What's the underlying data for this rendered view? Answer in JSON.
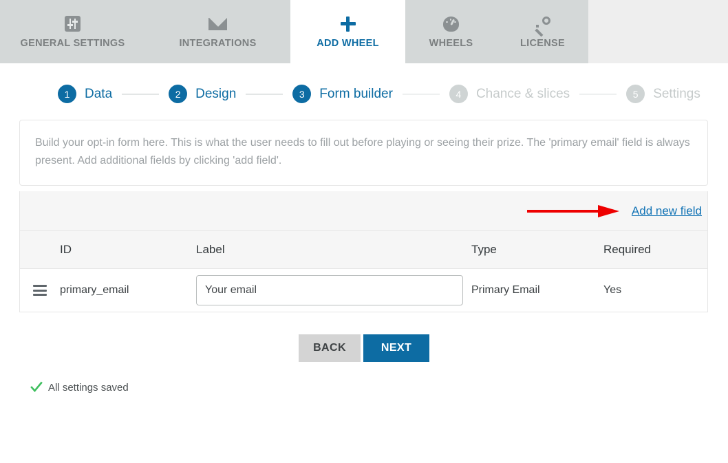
{
  "tabs": [
    {
      "label": "GENERAL SETTINGS",
      "icon": "sliders-icon",
      "active": false
    },
    {
      "label": "INTEGRATIONS",
      "icon": "envelope-icon",
      "active": false
    },
    {
      "label": "ADD WHEEL",
      "icon": "plus-icon",
      "active": true
    },
    {
      "label": "WHEELS",
      "icon": "gauge-icon",
      "active": false
    },
    {
      "label": "LICENSE",
      "icon": "key-icon",
      "active": false
    }
  ],
  "steps": [
    {
      "number": "1",
      "label": "Data",
      "active": true
    },
    {
      "number": "2",
      "label": "Design",
      "active": true
    },
    {
      "number": "3",
      "label": "Form builder",
      "active": true
    },
    {
      "number": "4",
      "label": "Chance & slices",
      "active": false
    },
    {
      "number": "5",
      "label": "Settings",
      "active": false
    }
  ],
  "description": "Build your opt-in form here. This is what the user needs to fill out before playing or seeing their prize. The 'primary email' field is always present. Add additional fields by clicking 'add field'.",
  "add_new_field_label": "Add new field",
  "table": {
    "headers": [
      "ID",
      "Label",
      "Type",
      "Required"
    ],
    "rows": [
      {
        "id": "primary_email",
        "label_value": "Your email",
        "label_placeholder": "Your email",
        "type": "Primary Email",
        "required": "Yes"
      }
    ]
  },
  "buttons": {
    "back": "BACK",
    "next": "NEXT"
  },
  "status": {
    "text": "All settings saved",
    "icon": "check-icon"
  },
  "colors": {
    "accent": "#0d6ca3",
    "link": "#1273b5",
    "tabbar": "#d4d8d8",
    "tabbar_right": "#eeeeee",
    "muted": "#9da2a5",
    "arrow_red": "#ee0000",
    "check_green": "#3fbf5f",
    "inactive_step": "#cfd4d4"
  }
}
